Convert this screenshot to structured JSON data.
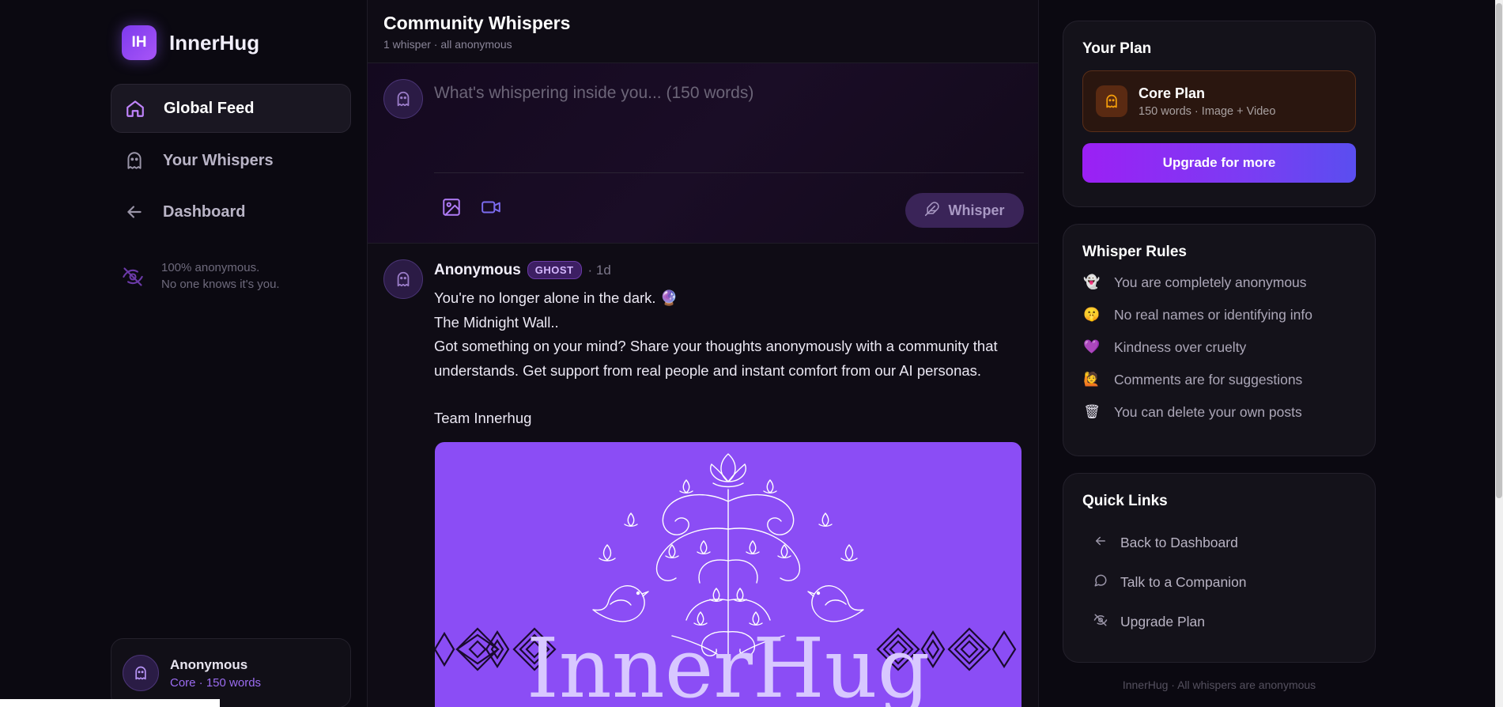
{
  "brand": {
    "logo_text": "IH",
    "name": "InnerHug"
  },
  "nav": [
    {
      "label": "Global Feed",
      "icon": "home-icon",
      "active": true
    },
    {
      "label": "Your Whispers",
      "icon": "ghost-icon",
      "active": false
    },
    {
      "label": "Dashboard",
      "icon": "arrow-left-icon",
      "active": false
    }
  ],
  "anon_note": {
    "line1": "100% anonymous.",
    "line2": "No one knows it's you."
  },
  "user": {
    "name": "Anonymous",
    "plan": "Core · 150 words"
  },
  "feed": {
    "title": "Community Whispers",
    "subtitle": "1 whisper · all anonymous"
  },
  "composer": {
    "placeholder": "What's whispering inside you... (150 words)",
    "submit_label": "Whisper"
  },
  "post": {
    "author": "Anonymous",
    "badge": "GHOST",
    "time": "· 1d",
    "lines": [
      "You're no longer alone in the dark. 🔮",
      "The Midnight Wall..",
      "Got something on your mind? Share your thoughts anonymously with a community that",
      "understands. Get support from real people and instant comfort from our AI personas."
    ],
    "signature": "Team Innerhug",
    "image_text": "InnerHug",
    "image_bg": "#8b4df5"
  },
  "plan_panel": {
    "title": "Your Plan",
    "plan_name": "Core Plan",
    "plan_desc": "150 words · Image + Video",
    "upgrade_label": "Upgrade for more"
  },
  "rules_panel": {
    "title": "Whisper Rules",
    "rules": [
      {
        "emoji": "👻",
        "text": "You are completely anonymous"
      },
      {
        "emoji": "🤫",
        "text": "No real names or identifying info"
      },
      {
        "emoji": "💜",
        "text": "Kindness over cruelty"
      },
      {
        "emoji": "🙋",
        "text": "Comments are for suggestions"
      },
      {
        "emoji": "🗑",
        "text": "You can delete your own posts"
      }
    ]
  },
  "links_panel": {
    "title": "Quick Links",
    "links": [
      {
        "icon": "arrow-left-icon",
        "text": "Back to Dashboard"
      },
      {
        "icon": "chat-bubble-icon",
        "text": "Talk to a Companion"
      },
      {
        "icon": "eye-off-icon",
        "text": "Upgrade Plan"
      }
    ]
  },
  "footer": "InnerHug · All whispers are anonymous",
  "colors": {
    "accent": "#8b5cf6",
    "upgrade_gradient_start": "#9b20f4",
    "upgrade_gradient_end": "#5a4ef0",
    "plan_bg": "#2a160f"
  }
}
